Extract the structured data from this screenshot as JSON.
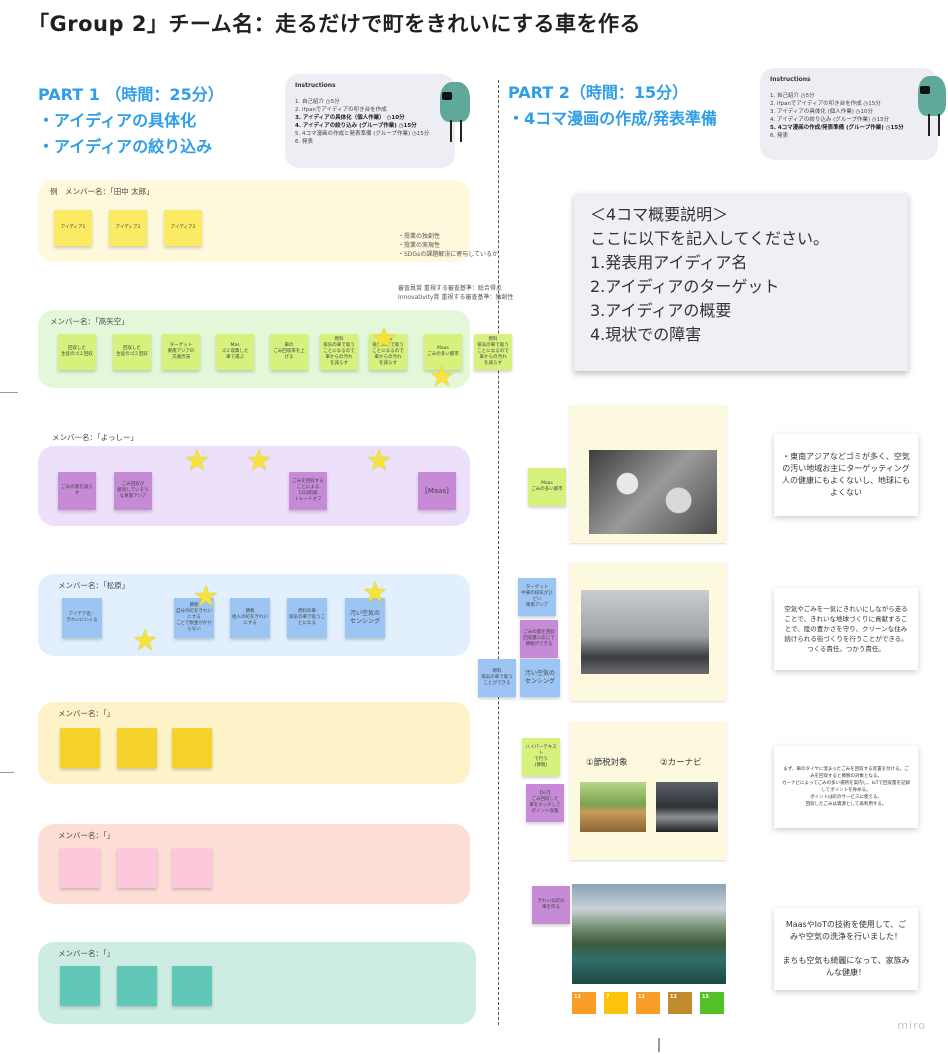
{
  "title": "「Group 2」チーム名：走るだけで町をきれいにする車を作る",
  "part1": {
    "heading": "PART 1 （時間：25分）",
    "bullets": [
      "・アイディアの具体化",
      "・アイディアの絞り込み"
    ]
  },
  "part2": {
    "heading": "PART 2（時間：15分）",
    "bullets": [
      "・4コマ漫画の作成/発表準備"
    ]
  },
  "instructions": {
    "heading": "Instructions",
    "items": [
      "1. 自己紹介",
      "2. ifpanでアイディアの叩き台を作成",
      "3. アイディアの具体化（個人作業）",
      "4. アイディアの絞り込み (グループ作業)",
      "5. 4コマ漫画の作成と発表準備 (グループ作業)",
      "6. 発表"
    ],
    "times": [
      "5分",
      "",
      "10分",
      "15分",
      "15分",
      ""
    ]
  },
  "instructions2": {
    "heading": "Instructions",
    "items": [
      "1. 自己紹介",
      "2. ifpanでアイディアの叩き台を作成",
      "3. アイディアの具体化 (個人作業)",
      "4. アイディアの絞り込み (グループ作業)",
      "5. 4コマ漫画の作成/発表準備 (グループ作業)",
      "6. 発表"
    ],
    "times": [
      "5分",
      "15分",
      "10分",
      "15分",
      "15分",
      ""
    ]
  },
  "rows": [
    {
      "label": "例　メンバー名：「田中 太郎」",
      "notes": [
        "アイディア1",
        "アイディア2",
        "アイディア3"
      ]
    },
    {
      "label": "メンバー名：「高矢空」",
      "notes": [
        "回収した\n生徒のゴミ回収",
        "回収した\n生徒のゴミ回収",
        "ターゲット\n東南アジアの\n交通渋滞",
        "Mas\nゴミ収集した\n車で運ぶ",
        "車の\nごみ回収率を上げる",
        "燃料\n排気の車で吸う\nことになるので\n車からの汚れ\nを減らす",
        "燃料\n排気の車で吸う\nことになるので\n車からの汚れ\nを減らす",
        "Maas\nごみの多い都市",
        "燃料\n排気の車で吸う\nことになるので\n車からの汚れ\nを減らす"
      ]
    },
    {
      "label": "メンバー名：「よっしー」",
      "notes": [
        "ごみの量を減らす",
        "ごみ回収が\n解消していそう\nな東南アジア",
        "ごみを回収することによる\nCO2削減\nトレードオフ",
        "[Maas]"
      ]
    },
    {
      "label": "メンバー名：「松原」",
      "notes": [
        "アイデア名：\nきれいにいくる",
        "節税\n自分の町をきれいにする\nことで税金がかからない",
        "節税\n他人の町をきれいにする",
        "燃料の車\n排気の車で吸うことになる",
        "汚い空気の\nセンシング"
      ]
    },
    {
      "label": "メンバー名：「」",
      "notes": [
        "",
        "",
        ""
      ]
    },
    {
      "label": "メンバー名：「」",
      "notes": [
        "",
        "",
        ""
      ]
    },
    {
      "label": "メンバー名：「」",
      "notes": [
        "",
        "",
        ""
      ]
    }
  ],
  "example_notes": [
    "・授業の独創性",
    "・授業の実現性",
    "・SDGsの課題解決に寄与しているか"
  ],
  "eval_notes": [
    "審査員賞 重視する審査基準：総合得点",
    "Innovativity賞 重視する審査基準：独創性"
  ],
  "overview": {
    "lines": [
      "＜4コマ概要説明＞",
      "ここに以下を記入してください。",
      "1.発表用アイディア名",
      "2.アイディアのターゲット",
      "3.アイディアの概要",
      "4.現状での障害"
    ]
  },
  "comic": {
    "panel3_labels": [
      "①節税対象",
      "②カーナビ"
    ],
    "side_notes": [
      "Maas\nごみの多い都市",
      "ターゲット\n中東の排気がひどい\n東南アジア",
      "ごみの量を回収\n回収量に応じて\n節税ができる",
      "燃料\n排気の車で吸う\nことができる",
      "汚い空気の\nセンシング",
      "ハイパーテキスト\nで行う\n(節税)",
      "【IoT】\nごみ回収した\n車をタッチして\nポイント収集",
      "きれいな町の\n車を作る"
    ],
    "descriptions": [
      "・東南アジアなどゴミが多く、空気の汚い地域お主にターゲッティング\n人の健康にもよくないし、地球にもよくない",
      "空気やごみを一気にきれいにしながら走ることで、きれいな地球づくりに貢献することで、陸の豊かさを守り、クリーンな住み続けられる街づくりを行うことができる。\nつくる責任。つかう責任。",
      "まず、車のタイヤに溜まったごみを回収する装置を付ける。ごみを回収すると節税の対象となる。\nカーナビによってごみの多い場所を案内し、IoTで回収量を記録してポイントを貯める。\nポイントは町のサービスに使える。\n回収したごみは資源として再利用する。",
      "MaasやIoTの技術を使用して、ごみや空気の洗浄を行いました！\n\nまちも空気も綺麗になって、家族みんな健康！"
    ]
  },
  "sdgs": [
    "11",
    "7",
    "11",
    "12",
    "15"
  ],
  "sdg_colors": [
    "#f99d26",
    "#fcc30b",
    "#f99d26",
    "#bf8b2e",
    "#56c02b"
  ],
  "brand": "miro"
}
